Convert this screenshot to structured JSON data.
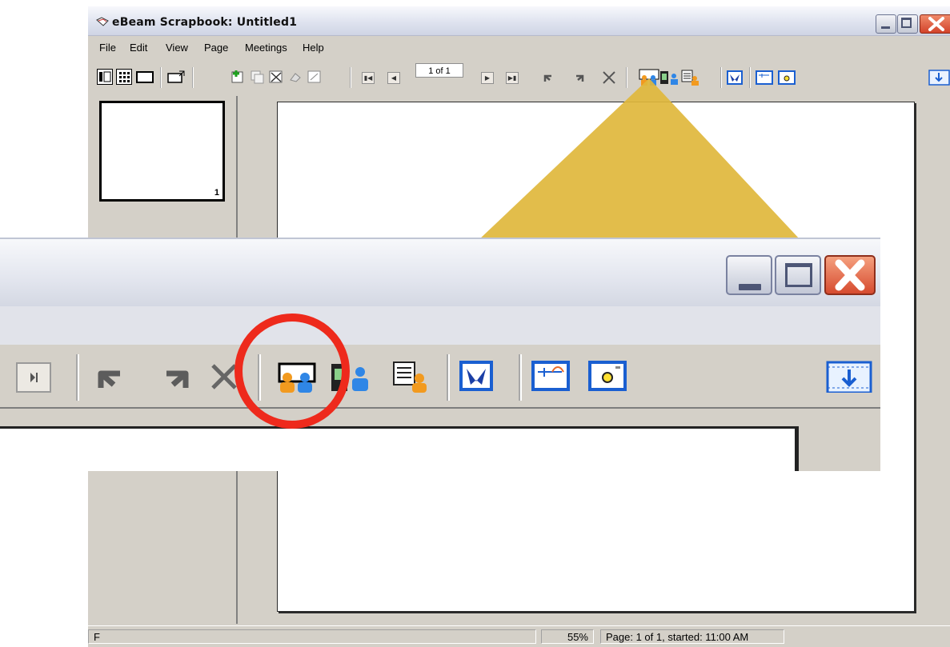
{
  "window": {
    "title": "eBeam Scrapbook: Untitled1",
    "icon": "scrapbook-app-icon"
  },
  "menu": {
    "items": [
      {
        "label": "File"
      },
      {
        "label": "Edit"
      },
      {
        "label": "View"
      },
      {
        "label": "Page"
      },
      {
        "label": "Meetings"
      },
      {
        "label": "Help"
      }
    ]
  },
  "toolbar": {
    "page_indicator": "1 of 1"
  },
  "thumbnail": {
    "page_number": "1"
  },
  "status": {
    "left": "F",
    "zoom": "55%",
    "info": "Page: 1 of 1, started: 11:00 AM"
  },
  "highlight": {
    "beam_color": "#e0b73c",
    "circle_color": "#ee2a1c",
    "target": "start-meeting-icon"
  },
  "colors": {
    "chrome": "#d4d0c8",
    "title_gradient_top": "#f7f8fc",
    "accent_blue": "#1a5fd1",
    "person_orange": "#f29a1f",
    "person_blue": "#2f86e6"
  }
}
